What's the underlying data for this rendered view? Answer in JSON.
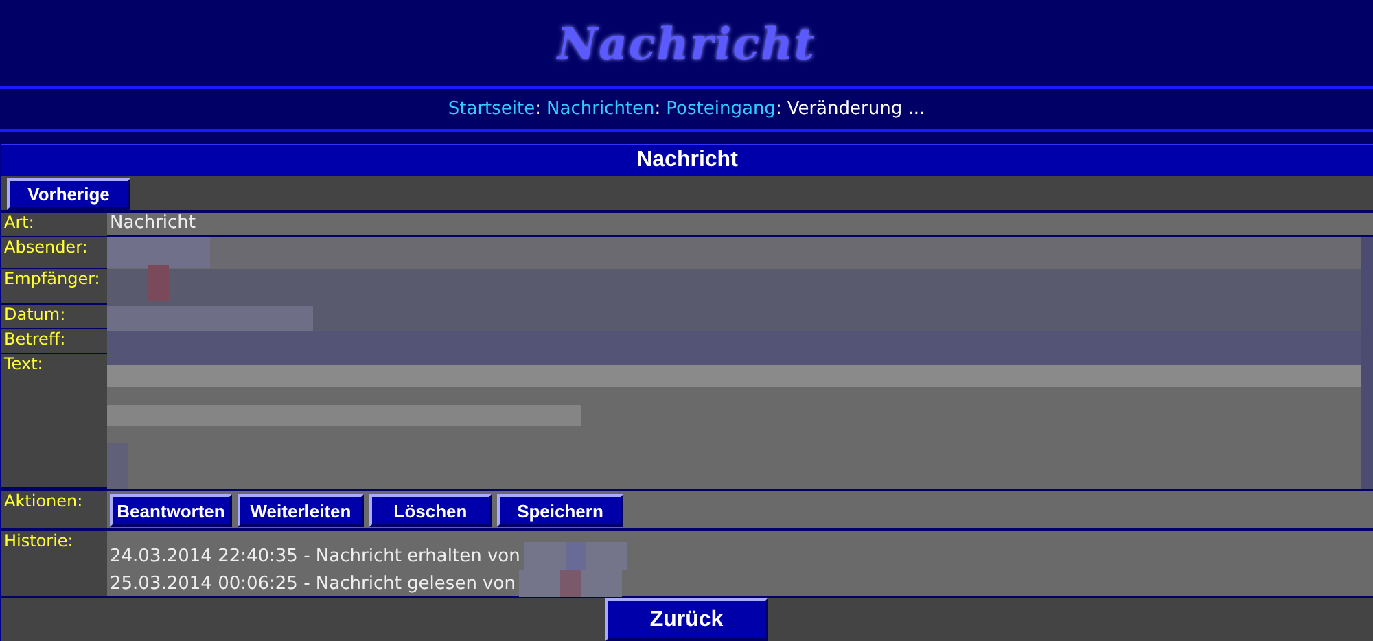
{
  "site_title": "Nachricht",
  "breadcrumb": [
    {
      "label": "Startseite",
      "kind": "link"
    },
    {
      "label": "Nachrichten",
      "kind": "link"
    },
    {
      "label": "Posteingang",
      "kind": "link"
    },
    {
      "label": "Veränderung ...",
      "kind": "current"
    }
  ],
  "breadcrumb_separator": ":",
  "panel_title": "Nachricht",
  "prev_button": "Vorherige",
  "fields": [
    {
      "label": "Art:",
      "value": "Nachricht"
    },
    {
      "label": "Absender:"
    },
    {
      "label": "Empfänger:"
    },
    {
      "label": "Datum:"
    },
    {
      "label": "Betreff:"
    },
    {
      "label": "Text:"
    }
  ],
  "actions_label": "Aktionen:",
  "actions": [
    "Beantworten",
    "Weiterleiten",
    "Löschen",
    "Speichern"
  ],
  "history_label": "Historie:",
  "history": [
    "24.03.2014 22:40:35 - Nachricht erhalten von",
    "25.03.2014 00:06:25 - Nachricht gelesen von"
  ],
  "back_button": "Zurück"
}
